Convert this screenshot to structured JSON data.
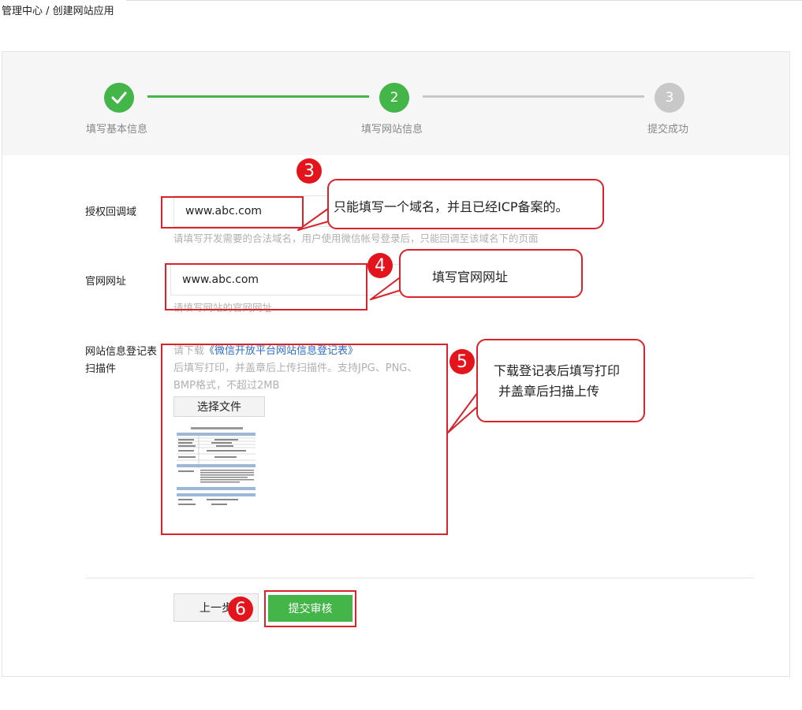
{
  "breadcrumb": "管理中心 / 创建网站应用",
  "steps": [
    {
      "number": "✓",
      "label": "填写基本信息",
      "state": "done"
    },
    {
      "number": "2",
      "label": "填写网站信息",
      "state": "current"
    },
    {
      "number": "3",
      "label": "提交成功",
      "state": "pending"
    }
  ],
  "fields": {
    "callback_domain": {
      "label": "授权回调域",
      "value": "www.abc.com",
      "hint": "请填写开发需要的合法域名，用户使用微信帐号登录后，只能回调至该域名下的页面"
    },
    "website_url": {
      "label": "官网网址",
      "value": "www.abc.com",
      "hint": "请填写网站的官网网址"
    },
    "scan_file": {
      "label_line1": "网站信息登记表",
      "label_line2": "扫描件",
      "download_prefix": "请下载",
      "download_link": "《微信开放平台网站信息登记表》",
      "instruction_line1": "后填写打印，并盖章后上传扫描件。支持JPG、PNG、",
      "instruction_line2": "BMP格式，不超过2MB",
      "choose_button": "选择文件"
    }
  },
  "annotations": {
    "badge3": "3",
    "callout3": "只能填写一个域名，并且已经ICP备案的。",
    "badge4": "4",
    "callout4": "填写官网网址",
    "badge5": "5",
    "callout5_line1": "下载登记表后填写打印",
    "callout5_line2": "并盖章后扫描上传",
    "badge6": "6"
  },
  "buttons": {
    "prev": "上一步",
    "submit": "提交审核"
  },
  "colors": {
    "accent_green": "#44b549",
    "annotation_red": "#d9222a",
    "link_blue": "#2f6cc8"
  }
}
